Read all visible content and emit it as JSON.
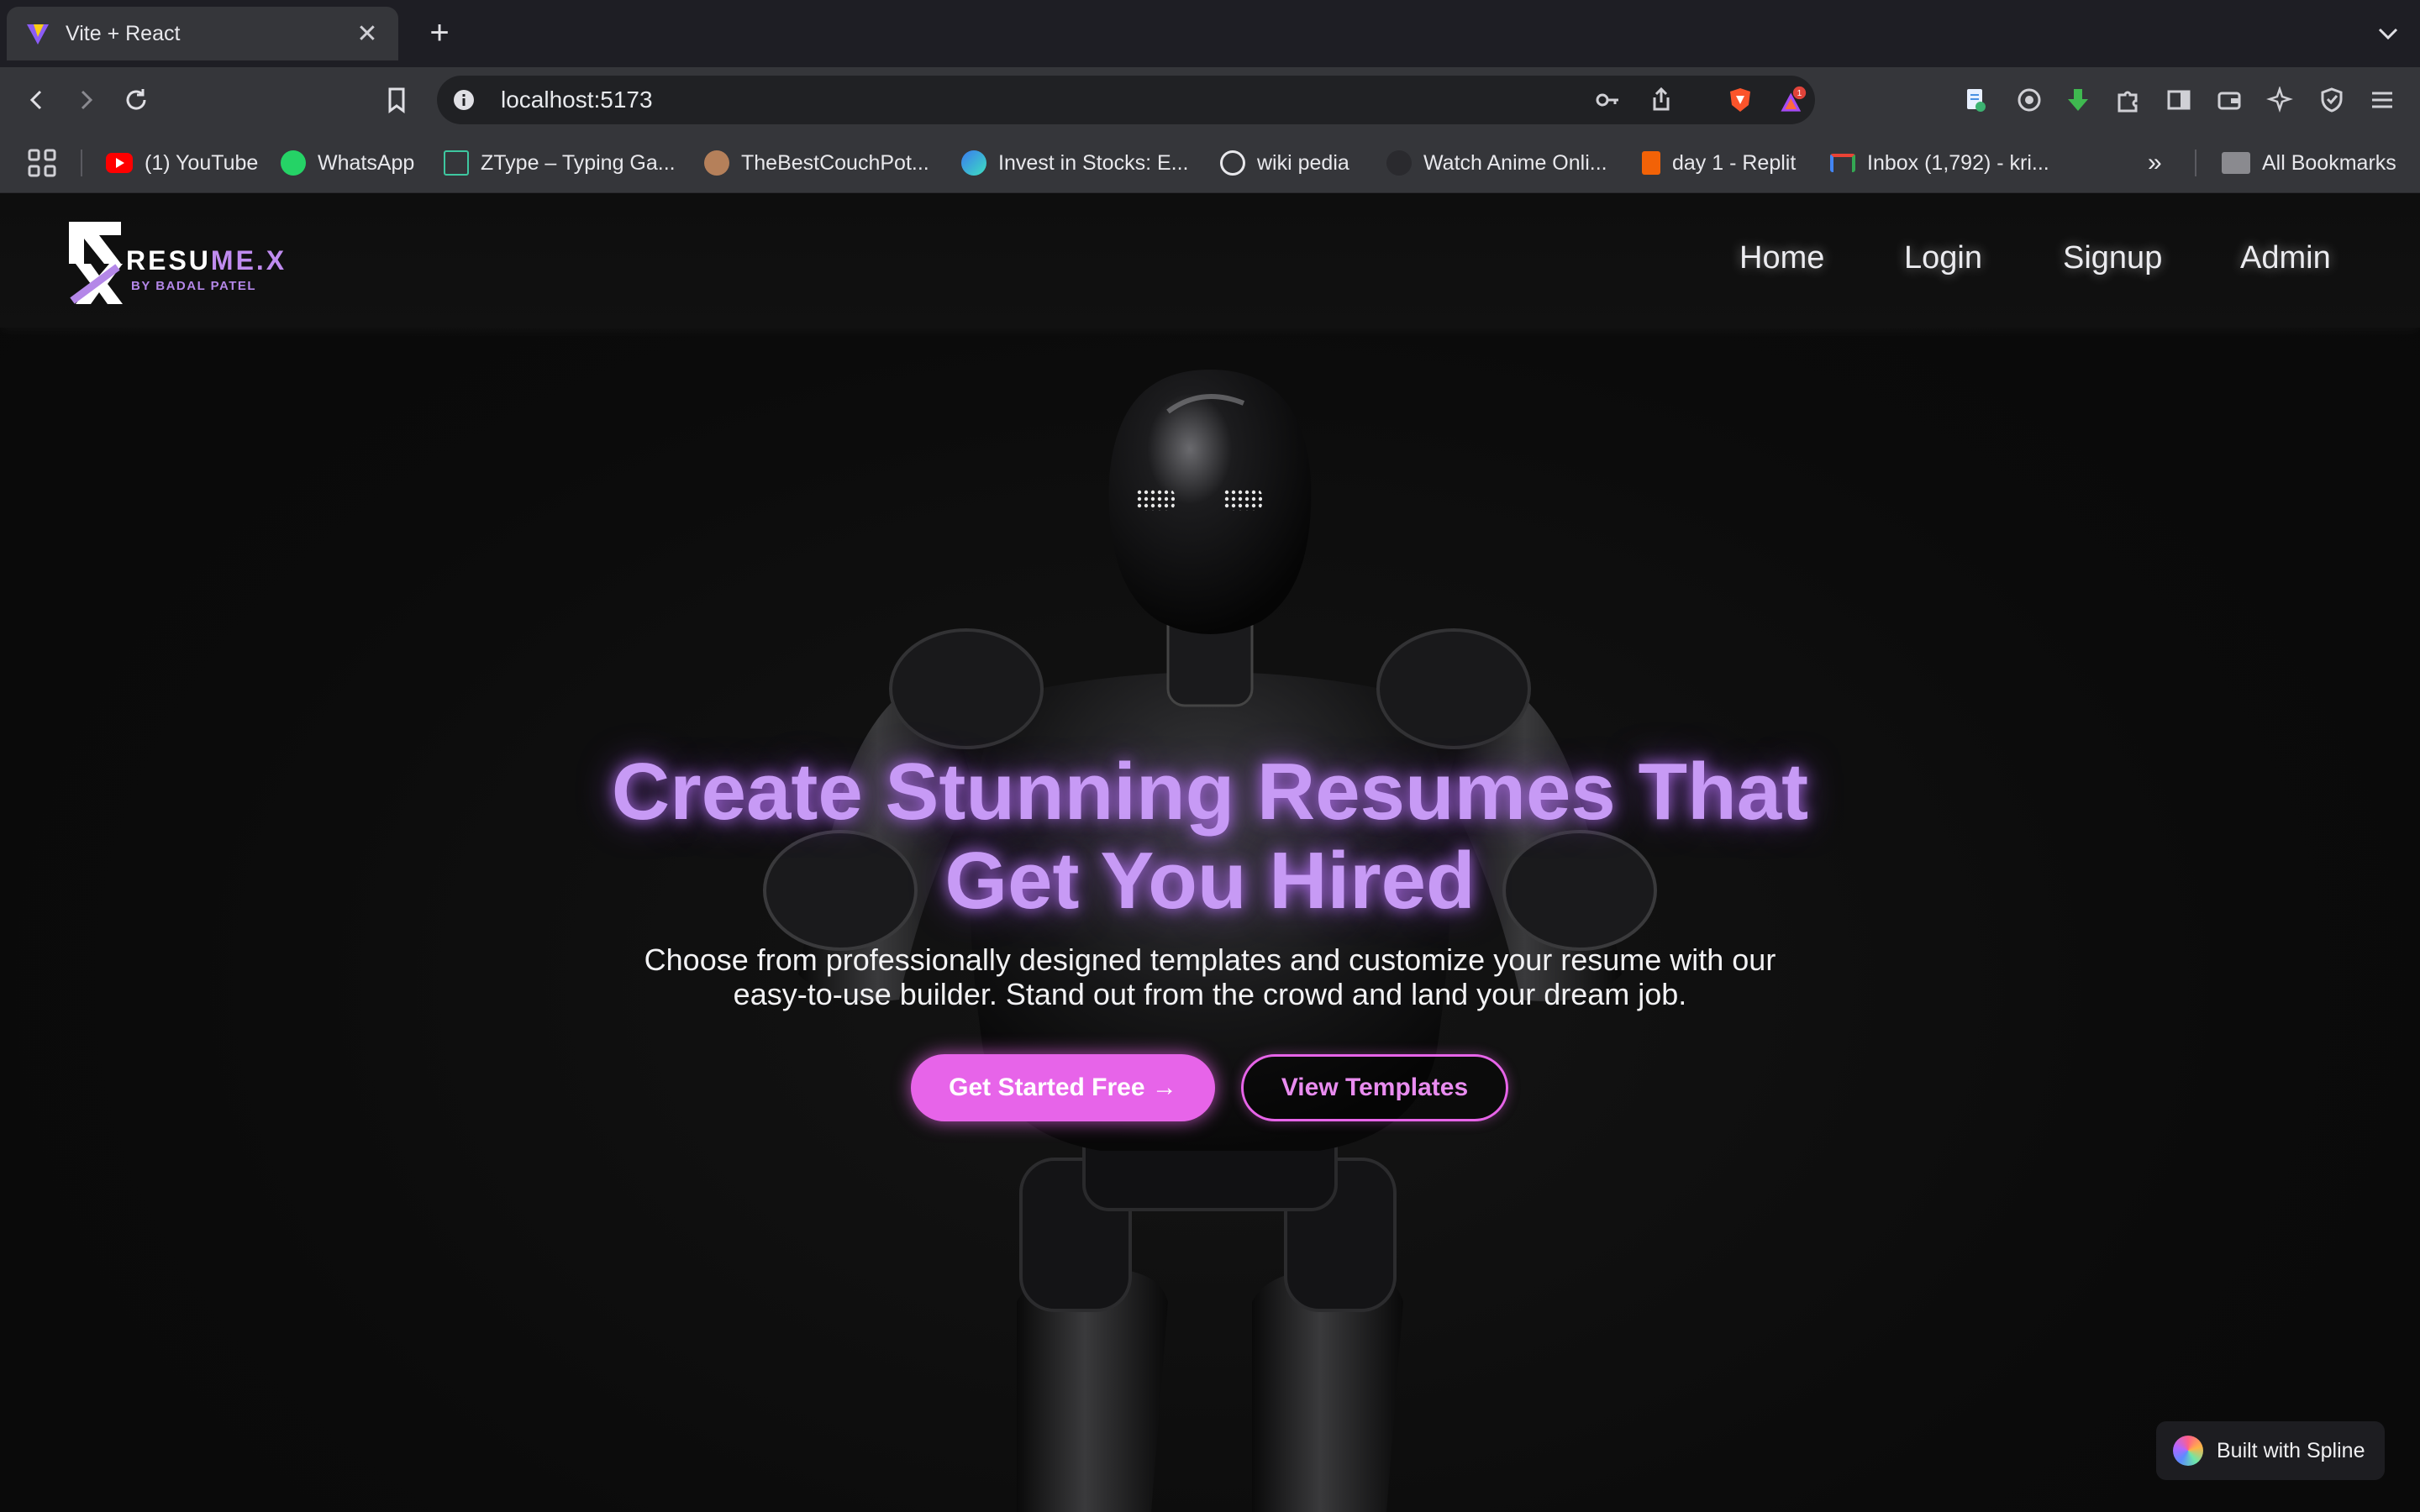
{
  "browser": {
    "tab_title": "Vite + React",
    "url": "localhost:5173",
    "notification_count": "1",
    "bookmarks": [
      {
        "label": "(1) YouTube",
        "icon": "youtube-icon",
        "color": "#ff0000"
      },
      {
        "label": "WhatsApp",
        "icon": "whatsapp-icon",
        "color": "#25d366"
      },
      {
        "label": "ZType – Typing Ga...",
        "icon": "ztype-icon",
        "color": "#3ec7a0"
      },
      {
        "label": "TheBestCouchPot...",
        "icon": "couchpotato-icon",
        "color": "#b5805a"
      },
      {
        "label": "Invest in Stocks: E...",
        "icon": "stocks-icon",
        "color": "#3a7bf0"
      },
      {
        "label": "wiki pedia",
        "icon": "openai-icon",
        "color": "#e8e8ec"
      },
      {
        "label": "Watch Anime Onli...",
        "icon": "anime-icon",
        "color": "#2a2a2e"
      },
      {
        "label": "day 1 - Replit",
        "icon": "replit-icon",
        "color": "#f26207"
      },
      {
        "label": "Inbox (1,792) - kri...",
        "icon": "gmail-icon",
        "color": "#ea4335"
      }
    ],
    "all_bookmarks_label": "All Bookmarks"
  },
  "site": {
    "logo": {
      "title_main": "RESU",
      "title_accent": "ME.X",
      "subtitle": "BY BADAL PATEL"
    },
    "nav": [
      "Home",
      "Login",
      "Signup",
      "Admin"
    ],
    "hero": {
      "headline": "Create Stunning Resumes That Get You Hired",
      "subtext": "Choose from professionally designed templates and customize your resume with our easy-to-use builder. Stand out from the crowd and land your dream job.",
      "primary_button": "Get Started Free →",
      "secondary_button": "View Templates"
    },
    "badge": "Built with Spline"
  },
  "colors": {
    "accent_purple": "#c79af5",
    "button_pink": "#e764e9",
    "background": "#0d0d0d"
  }
}
